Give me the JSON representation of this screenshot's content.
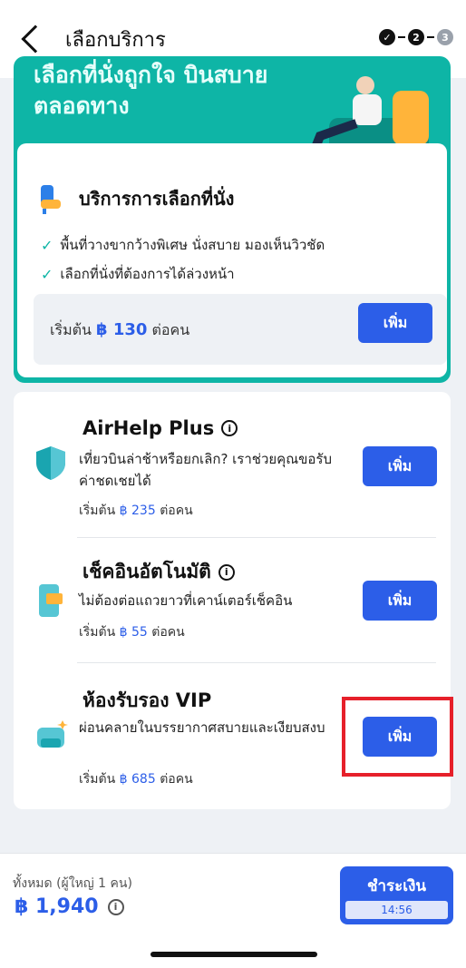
{
  "header": {
    "title": "เลือกบริการ",
    "steps": [
      "✓",
      "2",
      "3"
    ]
  },
  "hero": {
    "text_line1": "เลือกที่นั่งถูกใจ บินสบาย",
    "text_line2": "ตลอดทาง"
  },
  "seat_service": {
    "title": "บริการการเลือกที่นั่ง",
    "bullets": [
      "พื้นที่วางขากว้างพิเศษ นั่งสบาย มองเห็นวิวชัด",
      "เลือกที่นั่งที่ต้องการได้ล่วงหน้า"
    ],
    "price_prefix": "เริ่มต้น",
    "price": "฿ 130",
    "price_suffix": "ต่อคน",
    "add_label": "เพิ่ม"
  },
  "services": [
    {
      "title": "AirHelp Plus",
      "info": "i",
      "desc": "เที่ยวบินล่าช้าหรือยกเลิก? เราช่วยคุณขอรับค่าชดเชยได้",
      "price_prefix": "เริ่มต้น",
      "price": "฿ 235",
      "price_suffix": "ต่อคน",
      "add_label": "เพิ่ม"
    },
    {
      "title": "เช็คอินอัตโนมัติ",
      "info": "i",
      "desc": "ไม่ต้องต่อแถวยาวที่เคาน์เตอร์เช็คอิน",
      "price_prefix": "เริ่มต้น",
      "price": "฿ 55",
      "price_suffix": "ต่อคน",
      "add_label": "เพิ่ม"
    },
    {
      "title": "ห้องรับรอง VIP",
      "info": "",
      "desc": "ผ่อนคลายในบรรยากาศสบายและเงียบสงบ",
      "price_prefix": "เริ่มต้น",
      "price": "฿ 685",
      "price_suffix": "ต่อคน",
      "add_label": "เพิ่ม"
    }
  ],
  "footer": {
    "total_label": "ทั้งหมด (ผู้ใหญ่ 1 คน)",
    "total": "฿ 1,940",
    "info": "i",
    "pay_label": "ชำระเงิน",
    "timer": "14:56"
  },
  "colors": {
    "accent": "#2c5ee8",
    "teal": "#0eb5a6",
    "highlight": "#e6202a"
  }
}
